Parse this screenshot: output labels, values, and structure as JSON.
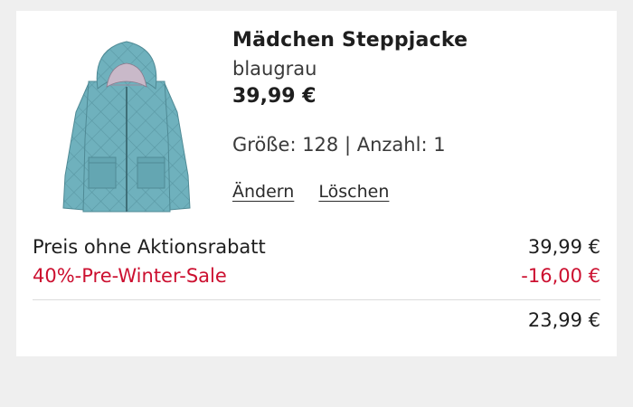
{
  "product": {
    "name": "Mädchen Steppjacke",
    "color": "blaugrau",
    "price": "39,99 €",
    "size_label": "Größe: 128",
    "separator": "|",
    "quantity_label": "Anzahl: 1",
    "image_icon": "blue-quilted-jacket-image"
  },
  "actions": {
    "edit_label": "Ändern",
    "delete_label": "Löschen"
  },
  "summary": {
    "base_label": "Preis ohne Aktionsrabatt",
    "base_value": "39,99 €",
    "discount_label": "40%-Pre-Winter-Sale",
    "discount_value": "-16,00 €",
    "total_value": "23,99 €"
  },
  "colors": {
    "discount": "#cc1030",
    "jacket": "#6fb1bd",
    "background": "#efefef",
    "card": "#ffffff"
  }
}
